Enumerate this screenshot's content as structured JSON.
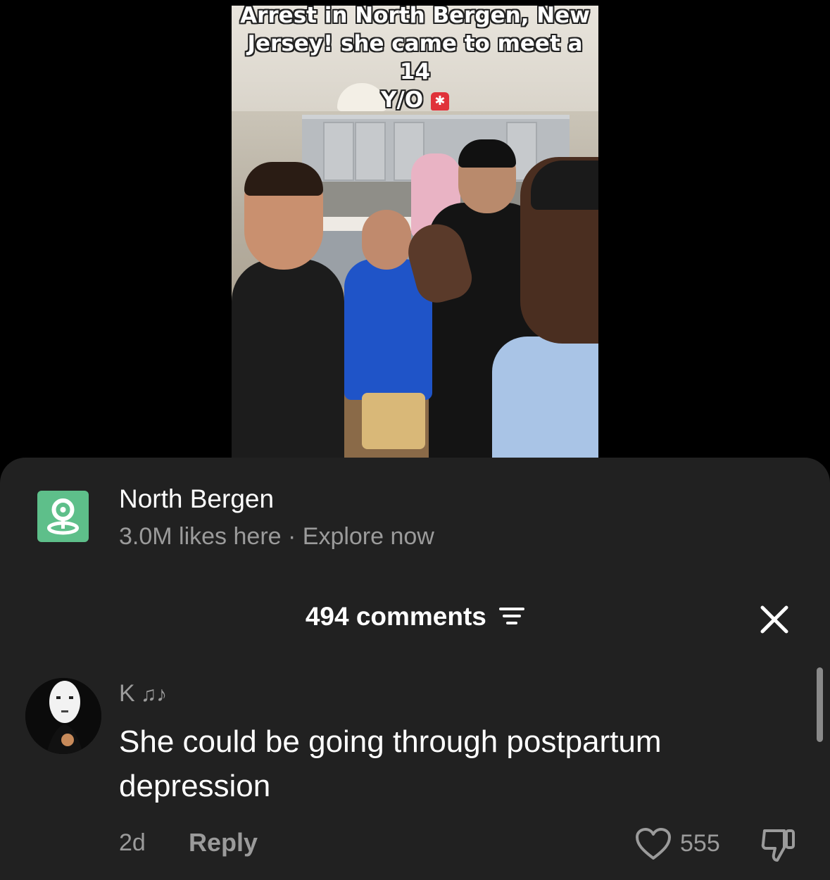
{
  "video": {
    "caption_line1": "Arrest in North Bergen, New",
    "caption_line2": "Jersey! she came to meet a 14",
    "caption_line3": "Y/O",
    "alarm_icon": "police-light-emoji"
  },
  "location": {
    "icon": "map-pin-icon",
    "name": "North Bergen",
    "subtitle": "3.0M likes here · Explore now"
  },
  "comments": {
    "header": "494 comments",
    "filter_icon": "filter-icon",
    "close_icon": "close-icon",
    "items": [
      {
        "username": "K",
        "username_decoration": "♫♪",
        "text": "She could be going through postpartum depression",
        "time": "2d",
        "reply_label": "Reply",
        "likes": "555"
      }
    ]
  },
  "colors": {
    "sheet_bg": "#212121",
    "muted_text": "#9b9b9b",
    "location_green": "#5ebf8a"
  }
}
